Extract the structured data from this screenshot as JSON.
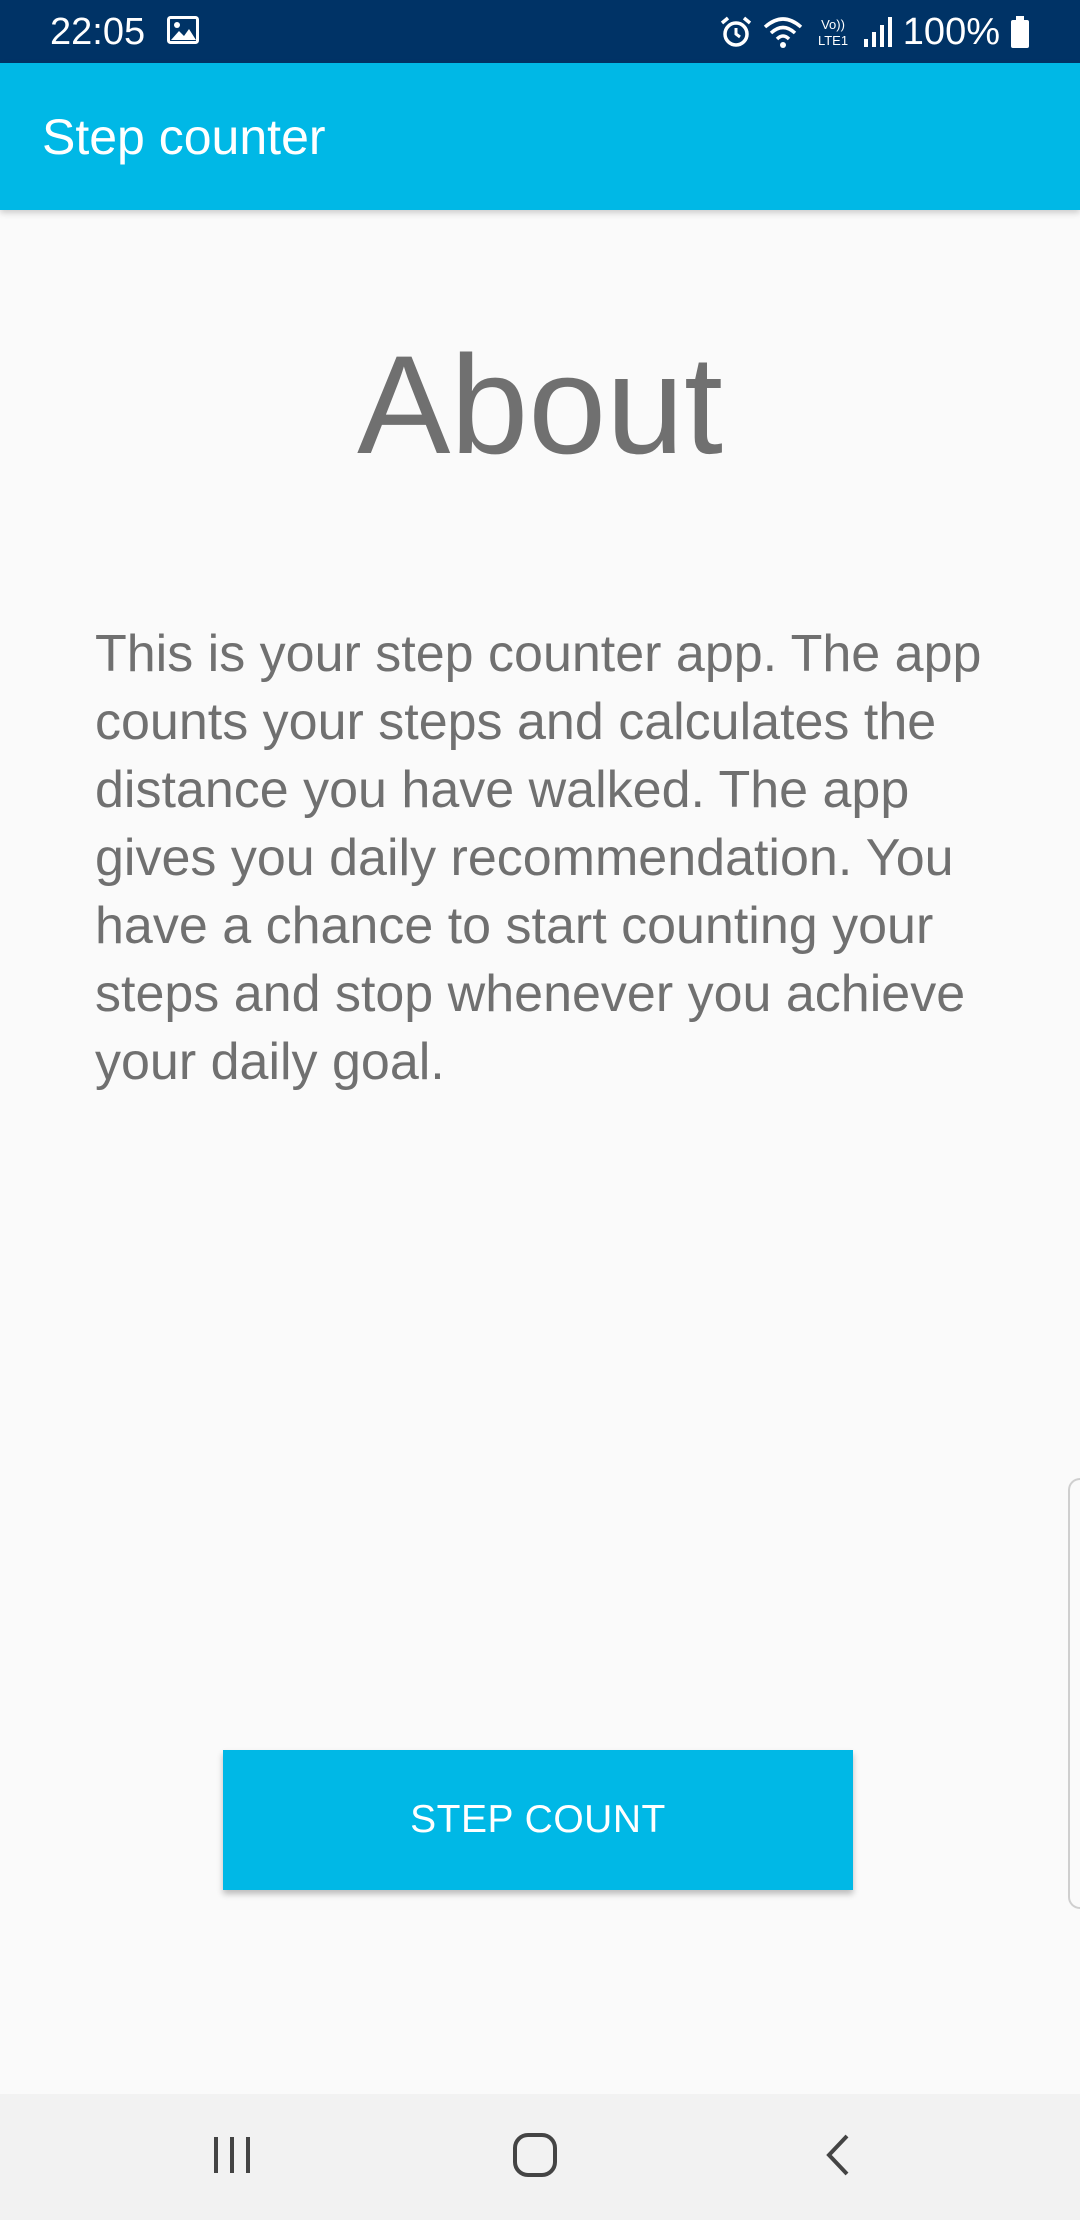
{
  "status_bar": {
    "time": "22:05",
    "battery_text": "100%",
    "icons": [
      "image-icon",
      "alarm-icon",
      "wifi-icon",
      "volte-icon",
      "signal-icon",
      "battery-icon"
    ],
    "background_color": "#003366"
  },
  "app_bar": {
    "title": "Step counter",
    "color": "#00b8e6"
  },
  "main": {
    "heading": "About",
    "description": "This is your step counter app. The app counts your steps and calculates the distance you have walked. The app gives you daily recommendation. You have a chance to start counting your steps and stop whenever you achieve your daily goal."
  },
  "actions": {
    "step_count_label": "STEP COUNT",
    "button_color": "#00b8e6"
  },
  "nav_bar": {
    "icons": [
      "recents-icon",
      "home-icon",
      "back-icon"
    ]
  }
}
